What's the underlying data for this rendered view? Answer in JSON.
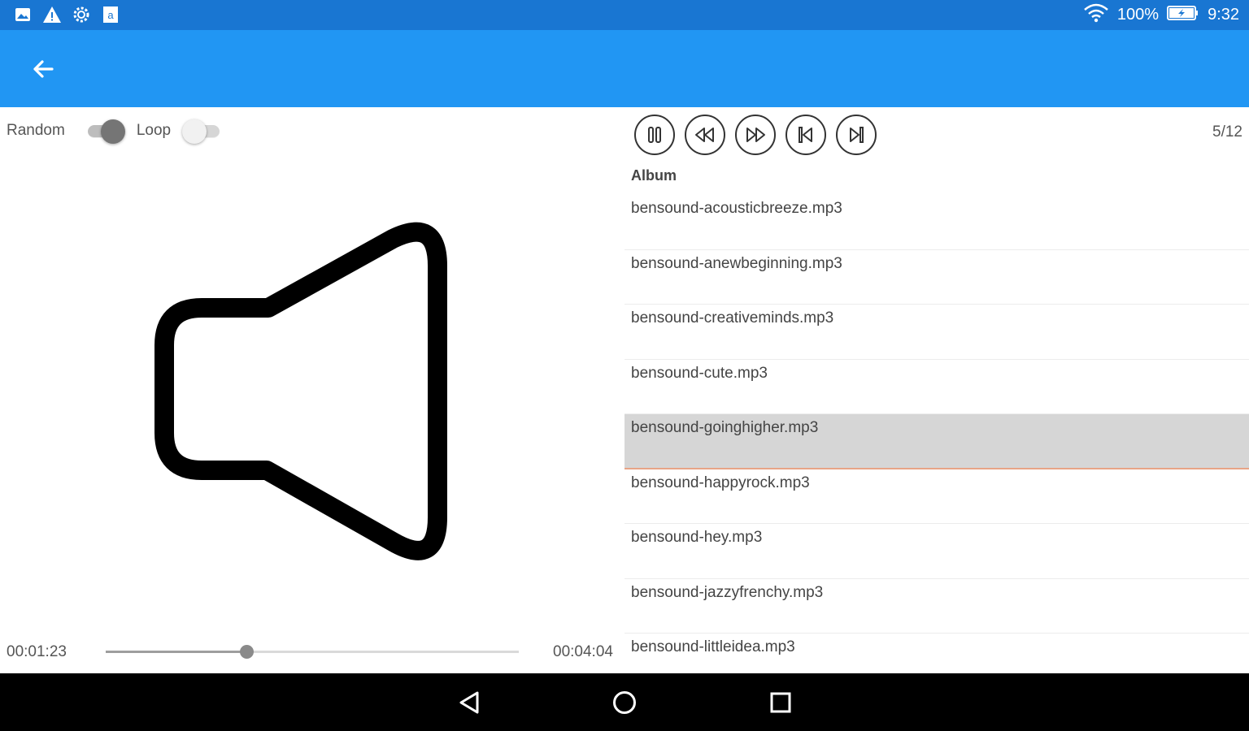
{
  "status_bar": {
    "icons": [
      "image-icon",
      "warning-icon",
      "settings-gear-icon",
      "store-bag-icon"
    ],
    "wifi_icon": "wifi-icon",
    "battery_percent": "100%",
    "battery_icon": "battery-charging-icon",
    "time": "9:32"
  },
  "app_bar": {
    "back_icon": "arrow-back-icon"
  },
  "options": {
    "random_label": "Random",
    "random_on": true,
    "loop_label": "Loop",
    "loop_on": false
  },
  "artwork": {
    "icon": "speaker-icon"
  },
  "progress": {
    "current_time": "00:01:23",
    "total_time": "00:04:04",
    "fraction": 0.34
  },
  "controls": [
    {
      "name": "pause-button",
      "icon": "pause-icon"
    },
    {
      "name": "rewind-button",
      "icon": "rewind-icon"
    },
    {
      "name": "fast-forward-button",
      "icon": "fast-forward-icon"
    },
    {
      "name": "skip-previous-button",
      "icon": "skip-previous-icon"
    },
    {
      "name": "skip-next-button",
      "icon": "skip-next-icon"
    }
  ],
  "playlist": {
    "counter": "5/12",
    "header": "Album",
    "selected_index": 4,
    "tracks": [
      "bensound-acousticbreeze.mp3",
      "bensound-anewbeginning.mp3",
      "bensound-creativeminds.mp3",
      "bensound-cute.mp3",
      "bensound-goinghigher.mp3",
      "bensound-happyrock.mp3",
      "bensound-hey.mp3",
      "bensound-jazzyfrenchy.mp3",
      "bensound-littleidea.mp3"
    ]
  },
  "nav_bar": {
    "icons": [
      "nav-back-icon",
      "nav-home-icon",
      "nav-recents-icon"
    ]
  },
  "colors": {
    "status_bar": "#1976d2",
    "app_bar": "#2196f3",
    "selected_row": "#d6d6d6",
    "selected_underline": "#e8a486"
  }
}
